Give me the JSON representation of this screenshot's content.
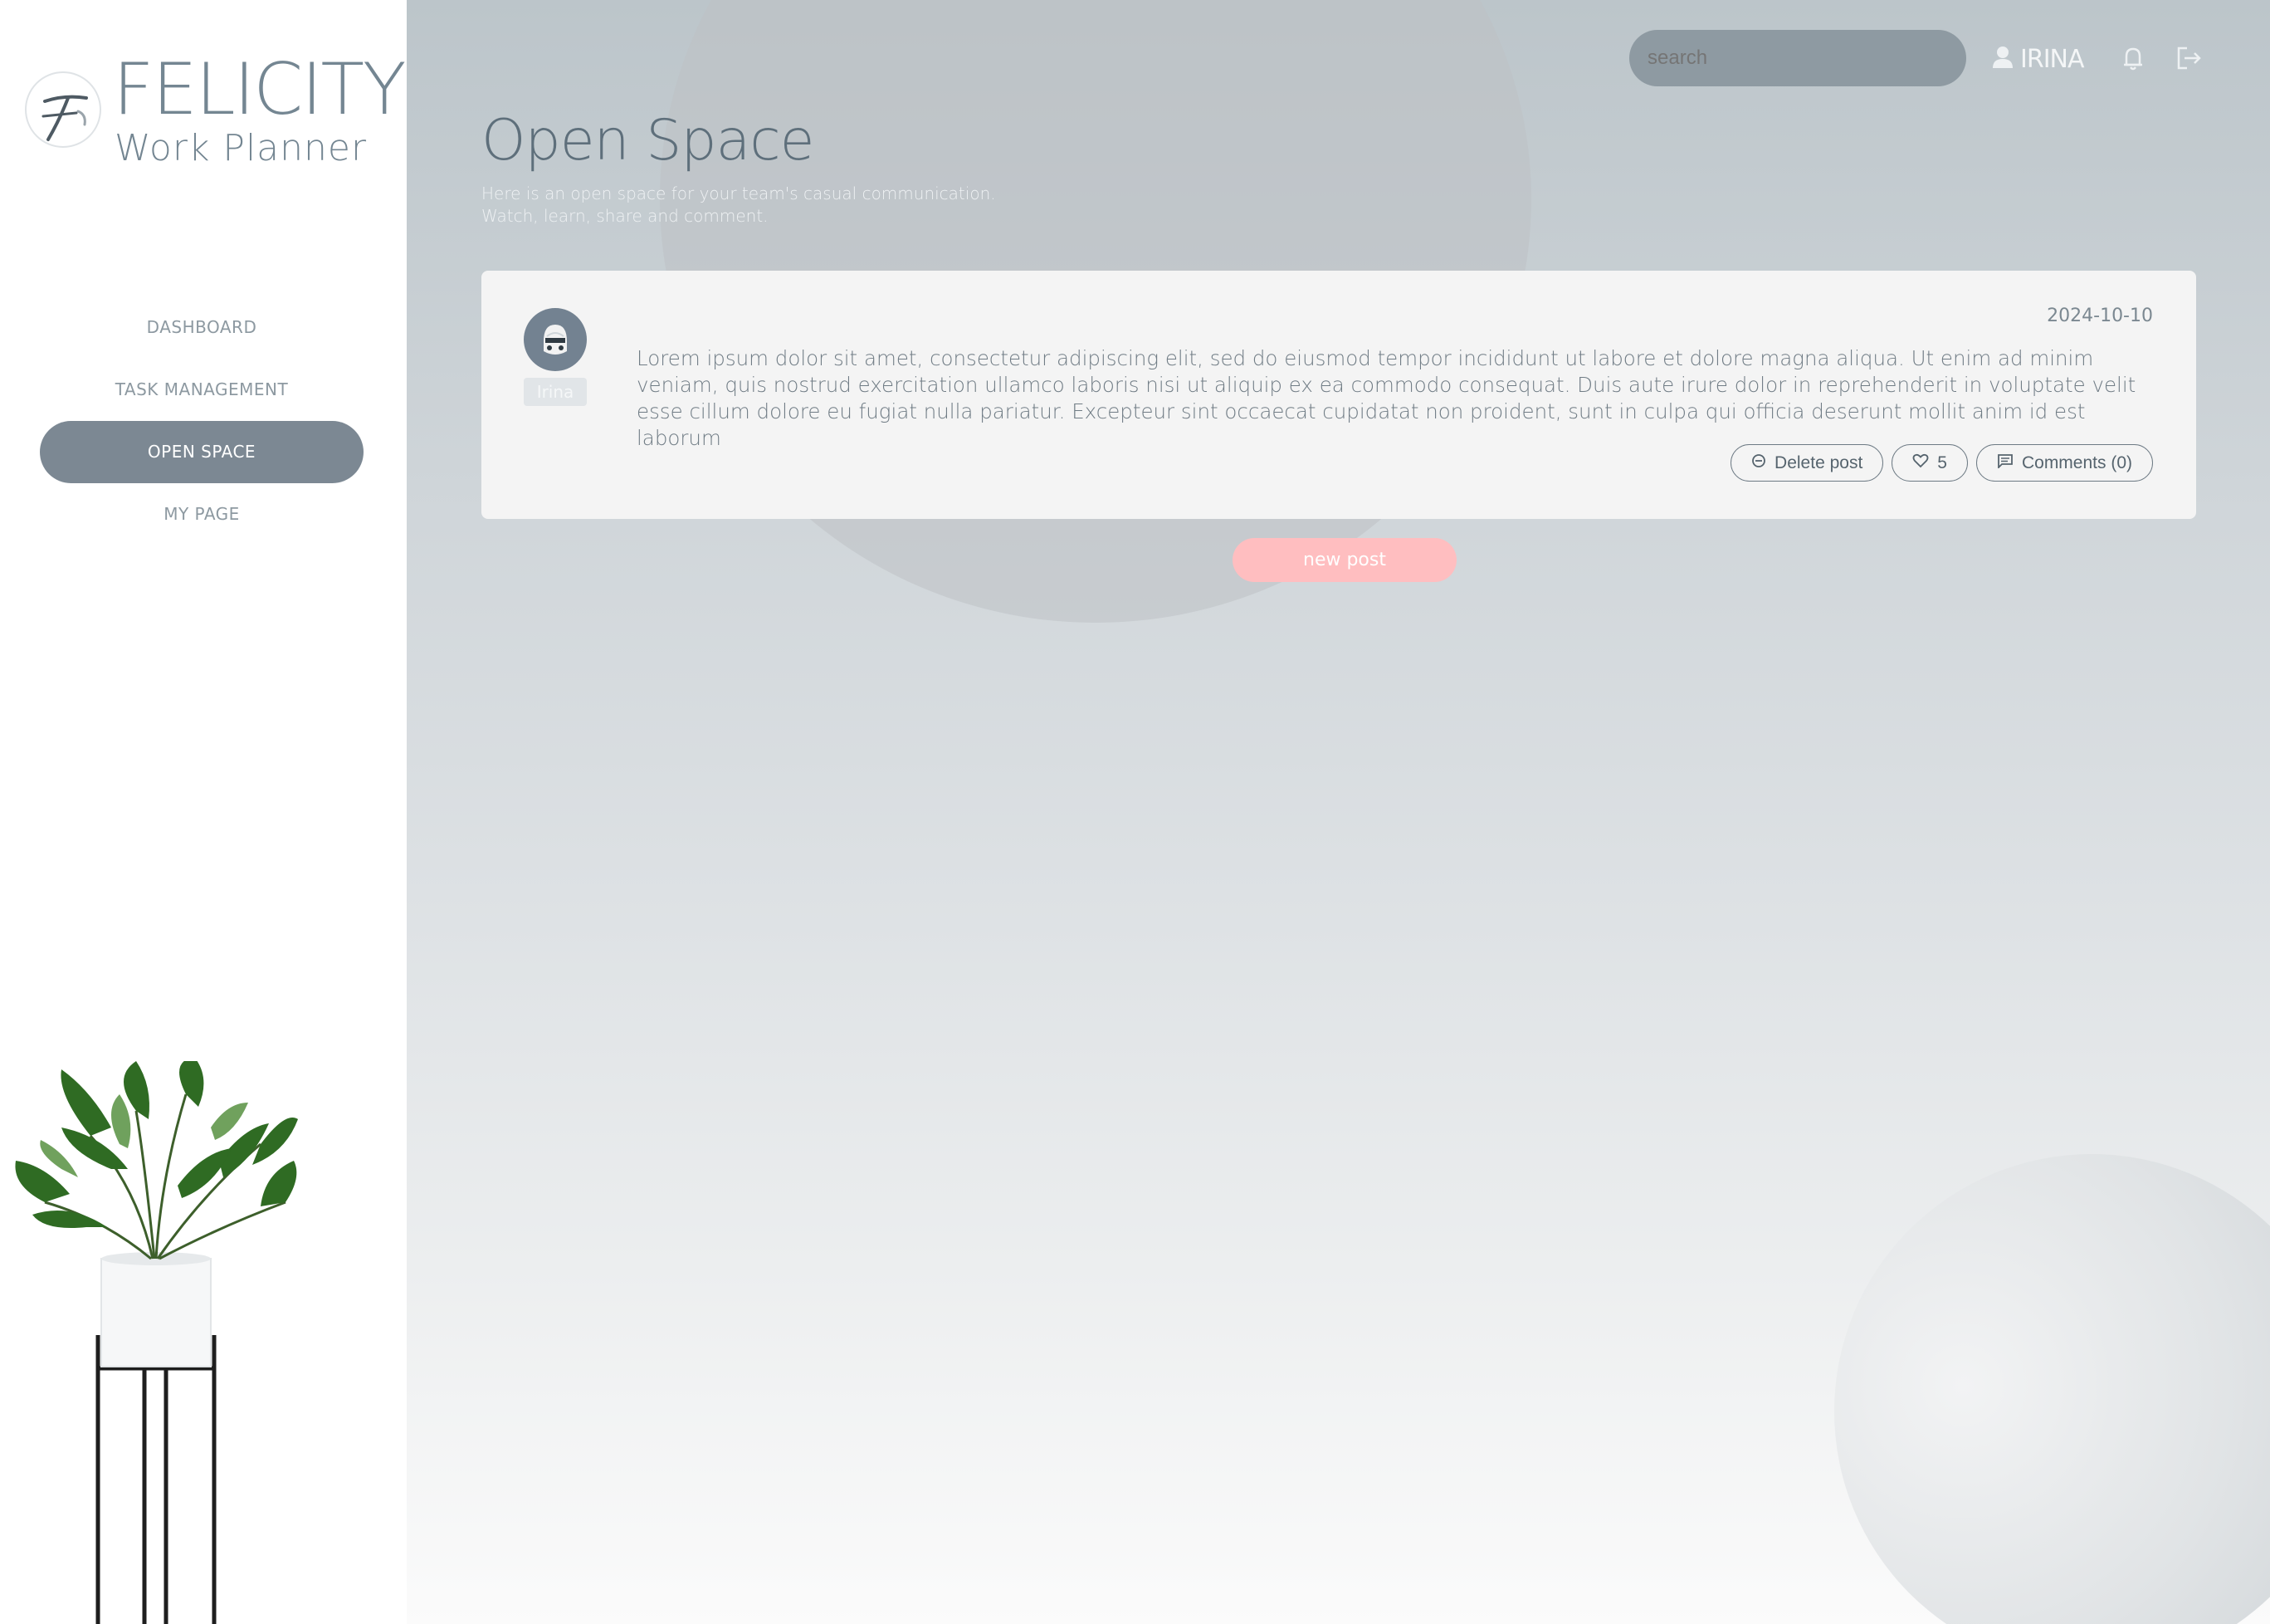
{
  "brand": {
    "title": "FELICITY",
    "subtitle": "Work Planner"
  },
  "nav": {
    "items": [
      {
        "label": "DASHBOARD",
        "active": false
      },
      {
        "label": "TASK MANAGEMENT",
        "active": false
      },
      {
        "label": "OPEN SPACE",
        "active": true
      },
      {
        "label": "MY PAGE",
        "active": false
      }
    ]
  },
  "header": {
    "search_placeholder": "search",
    "user_name": "IRINA"
  },
  "page": {
    "title": "Open Space",
    "description_line1": "Here is an open space for your team's casual communication.",
    "description_line2": "Watch, learn, share and comment."
  },
  "post": {
    "author": "Irina",
    "date": "2024-10-10",
    "text": "Lorem ipsum dolor sit amet, consectetur adipiscing elit, sed do eiusmod tempor incididunt ut labore et dolore magna aliqua. Ut enim ad minim veniam, quis nostrud exercitation ullamco laboris nisi ut aliquip ex ea commodo consequat. Duis aute irure dolor in reprehenderit in voluptate velit esse cillum dolore eu fugiat nulla pariatur. Excepteur sint occaecat cupidatat non proident, sunt in culpa qui officia deserunt mollit anim id est laborum",
    "delete_label": "Delete post",
    "like_count": "5",
    "comments_label": "Comments (0)"
  },
  "new_post_label": "new post",
  "colors": {
    "accent": "#7c8893",
    "new_post_button": "#ffbec0",
    "title": "#5e6f7b"
  }
}
